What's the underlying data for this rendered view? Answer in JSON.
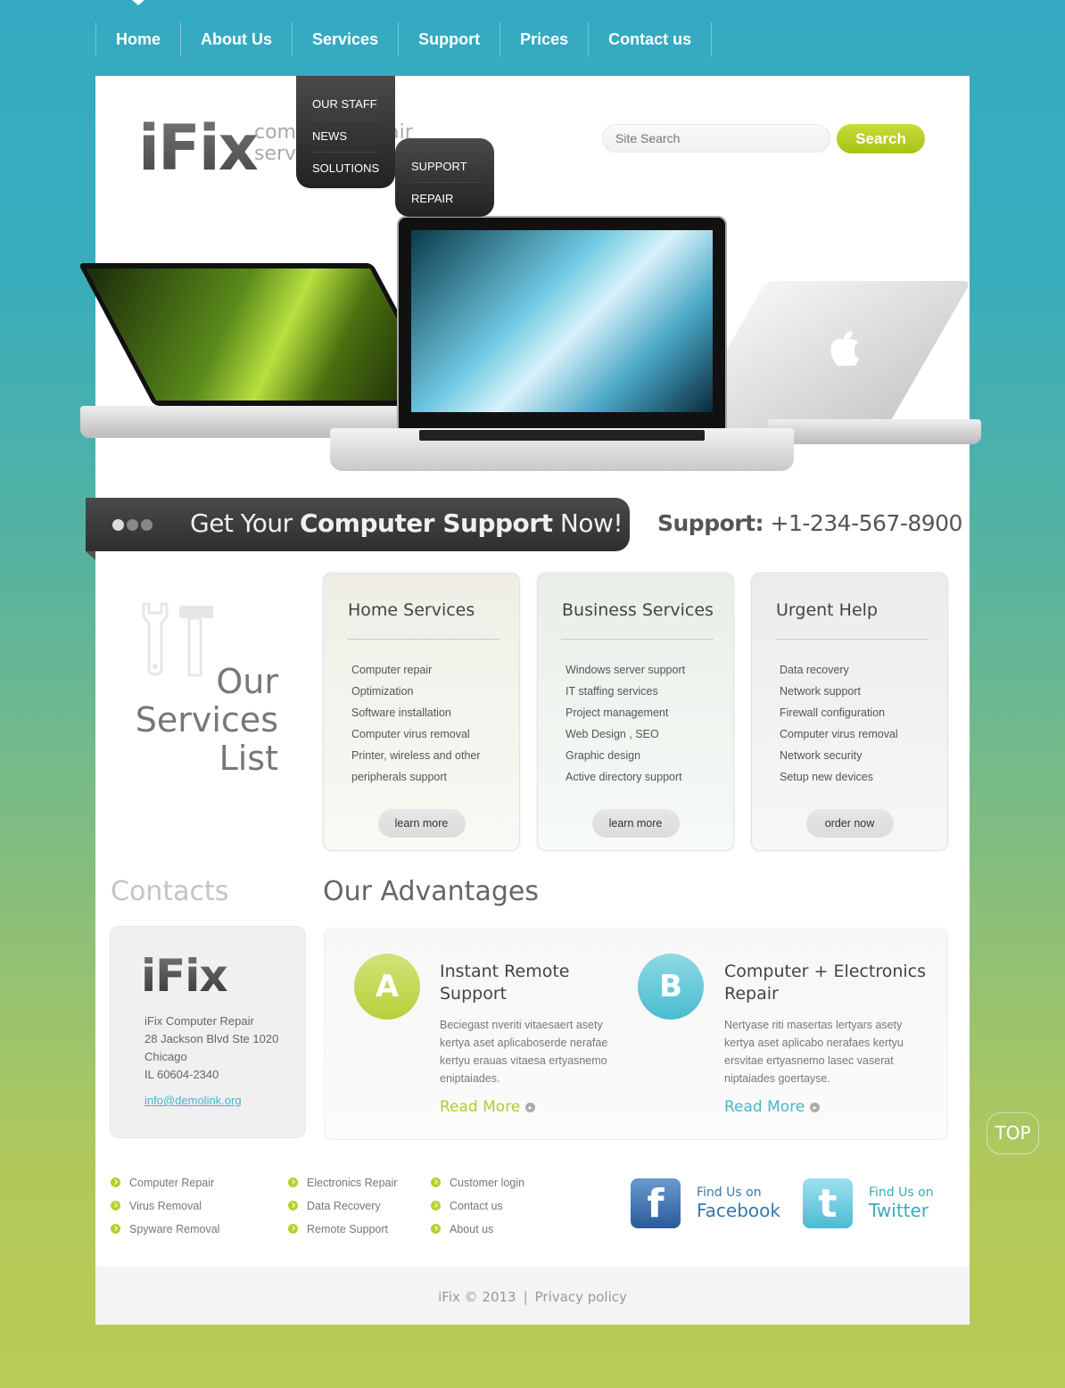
{
  "nav": {
    "items": [
      "Home",
      "About Us",
      "Services",
      "Support",
      "Prices",
      "Contact us"
    ],
    "active": "Home"
  },
  "header": {
    "logo": "iFix",
    "tagline_line1": "computer repair",
    "tagline_line2": "services",
    "search_placeholder": "Site Search",
    "search_button": "Search"
  },
  "dropdown": {
    "services_menu": [
      "OUR STAFF",
      "NEWS",
      "SOLUTIONS"
    ],
    "solutions_submenu": [
      "SUPPORT",
      "REPAIR"
    ]
  },
  "banner": {
    "text_pre": "Get Your ",
    "text_bold": "Computer Support",
    "text_post": " Now!",
    "slides": 3,
    "active_slide": 1,
    "support_label": "Support:",
    "support_phone": " +1-234-567-8900"
  },
  "services": {
    "heading_lines": [
      "Our",
      "Services",
      "List"
    ],
    "cards": [
      {
        "title": "Home Services",
        "items": [
          "Computer repair",
          "Optimization",
          "Software installation",
          "Computer virus removal",
          "Printer, wireless and other",
          "peripherals support"
        ],
        "button": "learn more"
      },
      {
        "title": "Business Services",
        "items": [
          "Windows server support",
          "IT staffing services",
          "Project management",
          "Web Design , SEO",
          "Graphic design",
          "Active directory support"
        ],
        "button": "learn more"
      },
      {
        "title": "Urgent Help",
        "items": [
          "Data recovery",
          "Network support",
          "Firewall configuration",
          "Computer virus removal",
          "Network security",
          "Setup new devices"
        ],
        "button": "order now"
      }
    ]
  },
  "contacts": {
    "heading": "Contacts",
    "logo": "iFix",
    "lines": [
      "iFix Computer Repair",
      "28 Jackson Blvd Ste 1020",
      "Chicago",
      "IL 60604-2340"
    ],
    "email": "info@demolink.org"
  },
  "advantages": {
    "heading": "Our Advantages",
    "items": [
      {
        "letter": "A",
        "title_line1": "Instant Remote",
        "title_line2": "Support",
        "text": "Beciegast nveriti vitaesaert asety kertya aset aplicaboserde nerafae kertyu erauas vitaesa ertyasnemo eniptaiades.",
        "link": "Read More",
        "color": "#b9cf3a"
      },
      {
        "letter": "B",
        "title_line1": "Computer + Electronics",
        "title_line2": "Repair",
        "text": "Nertyase riti masertas lertyars asety kertya aset aplicabo nerafaes kertyu ersvitae ertyasnemo lasec vaserat niptaiades goertayse.",
        "link": "Read More",
        "color": "#49bcd0"
      }
    ]
  },
  "footer_links": {
    "col1": [
      "Computer Repair",
      "Virus Removal",
      "Spyware Removal"
    ],
    "col2": [
      "Electronics Repair",
      "Data Recovery",
      "Remote Support"
    ],
    "col3": [
      "Customer login",
      "Contact us",
      "About us"
    ]
  },
  "social": {
    "facebook": {
      "small": "Find Us on",
      "big": "Facebook"
    },
    "twitter": {
      "small": "Find Us on",
      "big": "Twitter"
    }
  },
  "footer": {
    "copyright": "iFix © 2013",
    "separator": "|",
    "privacy": "Privacy policy"
  },
  "top_button": "TOP"
}
